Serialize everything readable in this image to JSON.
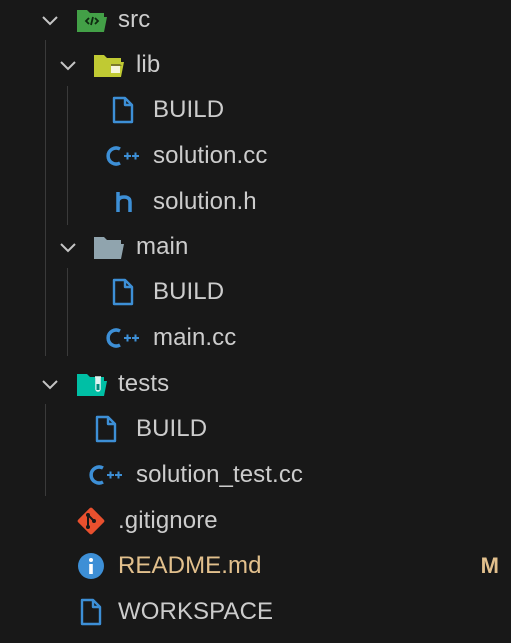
{
  "explorer": {
    "items": [
      {
        "label": "src",
        "icon": "folder-src-open-icon",
        "chevron": "chevron-down-icon"
      },
      {
        "label": "lib",
        "icon": "folder-lib-open-icon",
        "chevron": "chevron-down-icon"
      },
      {
        "label": "BUILD",
        "icon": "file-icon"
      },
      {
        "label": "solution.cc",
        "icon": "cpp-icon"
      },
      {
        "label": "solution.h",
        "icon": "header-h-icon"
      },
      {
        "label": "main",
        "icon": "folder-open-icon",
        "chevron": "chevron-down-icon"
      },
      {
        "label": "BUILD",
        "icon": "file-icon"
      },
      {
        "label": "main.cc",
        "icon": "cpp-icon"
      },
      {
        "label": "tests",
        "icon": "folder-tests-open-icon",
        "chevron": "chevron-down-icon"
      },
      {
        "label": "BUILD",
        "icon": "file-icon"
      },
      {
        "label": "solution_test.cc",
        "icon": "cpp-icon"
      },
      {
        "label": ".gitignore",
        "icon": "git-icon"
      },
      {
        "label": "README.md",
        "icon": "info-icon",
        "badge": "M"
      },
      {
        "label": "WORKSPACE",
        "icon": "file-icon"
      }
    ]
  },
  "colors": {
    "background": "#181818",
    "text": "#cccccc",
    "modified": "#e2c08d",
    "file_icon": "#3d8fd6",
    "cpp_icon": "#3d8fd6",
    "git_icon": "#e8502e",
    "src_folder": "#43a047",
    "lib_folder": "#c0ca33",
    "main_folder": "#90a4ae",
    "tests_folder": "#00bfa5"
  }
}
